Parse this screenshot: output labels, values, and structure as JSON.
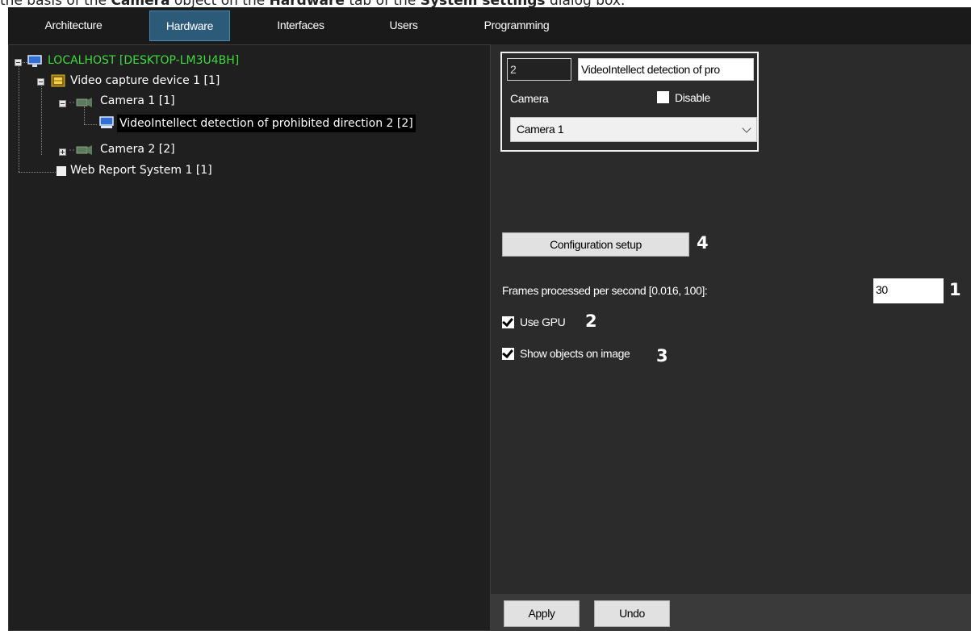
{
  "caption": {
    "part1": "the basis of the ",
    "bold1": "Camera",
    "part2": " object on the ",
    "bold2": "Hardware",
    "part3": " tab of the ",
    "bold3": "System settings",
    "part4": " dialog box."
  },
  "tabs": [
    "Architecture",
    "Hardware",
    "Interfaces",
    "Users",
    "Programming"
  ],
  "active_tab": "Hardware",
  "tree": {
    "root": "LOCALHOST [DESKTOP-LM3U4BH]",
    "video_capture": "Video capture device 1 [1]",
    "camera1": "Camera 1 [1]",
    "detector": "VideoIntellect detection of prohibited direction 2 [2]",
    "camera2": "Camera 2 [2]",
    "web_report": "Web Report System 1 [1]"
  },
  "object": {
    "id_value": "2",
    "name_value": "VideoIntellect detection of pro",
    "camera_label": "Camera",
    "disable_label": "Disable",
    "camera_selected": "Camera 1"
  },
  "settings": {
    "config_button": "Configuration setup",
    "fps_label": "Frames processed per second [0.016, 100]:",
    "fps_value": "30",
    "use_gpu_label": "Use GPU",
    "show_objects_label": "Show objects on image",
    "use_gpu_checked": true,
    "show_objects_checked": true,
    "disable_checked": false
  },
  "callouts": {
    "fps": "1",
    "gpu": "2",
    "show": "3",
    "config": "4"
  },
  "buttons": {
    "apply": "Apply",
    "undo": "Undo"
  },
  "colors": {
    "tab_active": "#2c5b7a",
    "root_text": "#3edb3e",
    "panel_bg": "#2b2b2b"
  }
}
